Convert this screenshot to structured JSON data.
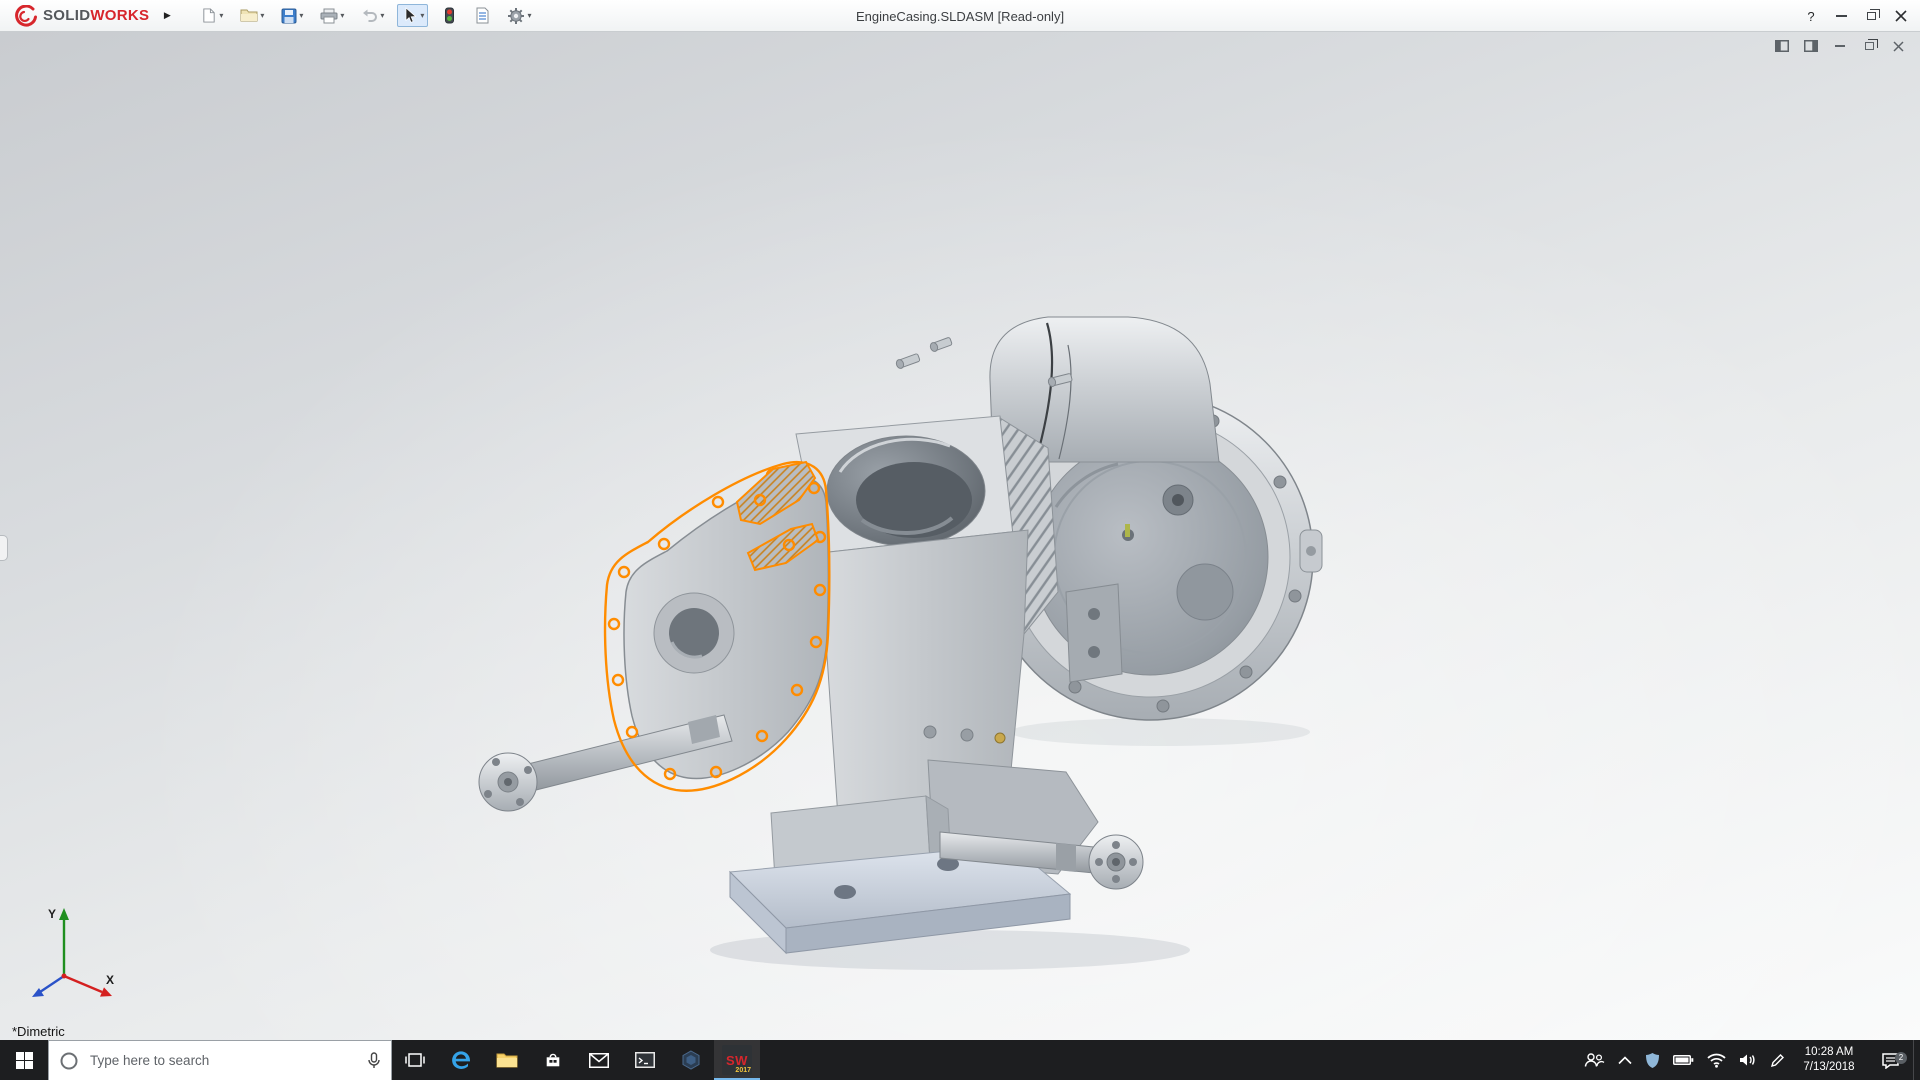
{
  "titlebar": {
    "brand": {
      "solid": "SOLID",
      "works": "WORKS"
    },
    "document_title": "EngineCasing.SLDASM [Read-only]",
    "help_label": "?"
  },
  "icons": {
    "flyout": "▶",
    "caret": "▾"
  },
  "viewport": {
    "orientation_label": "*Dimetric",
    "triad": {
      "x": "X",
      "y": "Y"
    }
  },
  "taskbar": {
    "search": {
      "placeholder": "Type here to search"
    },
    "solidworks": {
      "letters": "SW",
      "year": "2017"
    },
    "tray": {
      "time": "10:28 AM",
      "date": "7/13/2018",
      "badge_count": "2"
    }
  },
  "colors": {
    "selection-orange": "#ff8c00",
    "accent-red": "#d7262c",
    "taskbar-bg": "#1d1e20",
    "active-underline": "#76b9ed"
  }
}
